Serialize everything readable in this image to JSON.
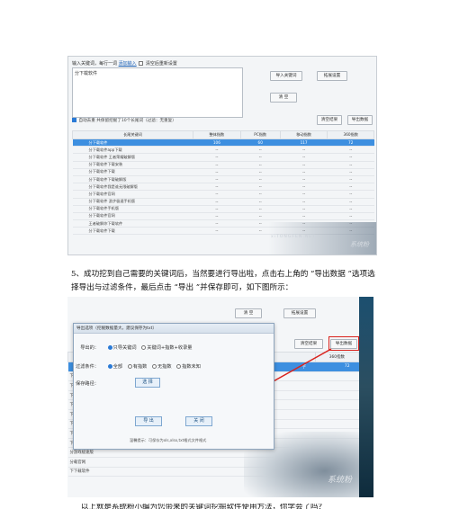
{
  "shot1": {
    "prompt": "输入关键词，每行一词",
    "prompt_link": "添加输入",
    "prompt_check": "清空后重新设置",
    "textarea_value": "分下载软件",
    "buttons": [
      "导入关键词",
      "清 空",
      "拓展设置"
    ],
    "options_text": "自动去重  共保留挖掘了10个长尾词（过滤：无重复）",
    "buttons2": [
      "清空结果",
      "导出数据"
    ],
    "table_headers": [
      "长尾关键词",
      "整体指数",
      "PC指数",
      "移动指数",
      "360指数"
    ],
    "rows": [
      {
        "kw": "分下载软件",
        "vals": [
          "106",
          "60",
          "117",
          "72"
        ],
        "selected": true
      },
      {
        "kw": "分下载软件app下载",
        "vals": [
          "--",
          "--",
          "--",
          "--"
        ]
      },
      {
        "kw": "分下载软件 王者荣耀破解版",
        "vals": [
          "--",
          "--",
          "--",
          "--"
        ]
      },
      {
        "kw": "分下载软件下载安装",
        "vals": [
          "--",
          "--",
          "--",
          "--"
        ]
      },
      {
        "kw": "分下载软件下载",
        "vals": [
          "--",
          "--",
          "--",
          "--"
        ]
      },
      {
        "kw": "分下载软件下载破解版",
        "vals": [
          "--",
          "--",
          "--",
          "--"
        ]
      },
      {
        "kw": "分下载软件我是谁无限破解版",
        "vals": [
          "--",
          "--",
          "--",
          "--"
        ]
      },
      {
        "kw": "分下载软件官网",
        "vals": [
          "--",
          "--",
          "--",
          "--"
        ]
      },
      {
        "kw": "分下载软件 游步极速手机版",
        "vals": [
          "--",
          "--",
          "--",
          "--"
        ]
      },
      {
        "kw": "分下载软件手机版",
        "vals": [
          "--",
          "--",
          "--",
          "--"
        ]
      },
      {
        "kw": "分下载软件官网",
        "vals": [
          "--",
          "--",
          "--",
          "--"
        ]
      },
      {
        "kw": "王者破解你下载软件",
        "vals": [
          "--",
          "--",
          "--",
          "--"
        ]
      },
      {
        "kw": "分下载软件下载",
        "vals": [
          "--",
          "--",
          "--",
          "--"
        ]
      }
    ],
    "watermark": "系统粉",
    "watermark2": "xiTONGFEN.NET"
  },
  "paragraph": "5、成功挖到自己需要的关键词后，当然要进行导出啦，点击右上角的 “导出数据 ”选项选择导出与过滤条件，最后点击 “导出 ”并保存即可，如下图所示：",
  "shot2": {
    "dialog_title": "导出选项（挖掘数据量大，建议保存为txt）",
    "export_label": "导出的：",
    "export_opts": [
      "只导关键词",
      "关键词+指数+收录量"
    ],
    "filter_label": "过滤条件：",
    "filter_opts": [
      "全部",
      "有指数",
      "无指数",
      "指数未知"
    ],
    "path_label": "保存路径：",
    "choose_btn": "选 择",
    "export_btn": "导 出",
    "close_btn": "关 闭",
    "hint": "温馨提示：可保存为xls,xlsx,txt格式文件格式",
    "bg_buttons": [
      "清 空",
      "拓展设置",
      "清空结果",
      "导出数据"
    ],
    "bg_header_last": "360指数",
    "bg_value": "72",
    "bg_rows": [
      "",
      "",
      "",
      "",
      "下载安装",
      "",
      "下载破解",
      "王者荣耀破解版",
      "载官网",
      "游戏极速版",
      "载官网",
      "下载软件"
    ],
    "row_left_prefix": [
      "字",
      "下载",
      "下载",
      "下载",
      "下载",
      "下载",
      "下载",
      "下",
      "下",
      "分",
      "分",
      "下"
    ],
    "watermark": "系统粉"
  },
  "bottom_text": "以上就是系统粉小编为您带来的关键词挖掘软件使用方法，你学会了吗？"
}
